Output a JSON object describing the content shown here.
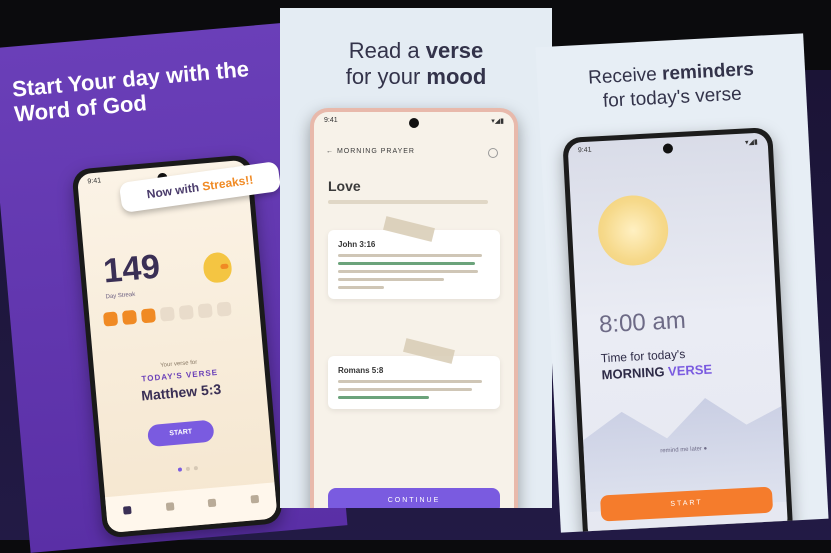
{
  "panel1": {
    "headline": "Start Your day with the Word of God",
    "status_time": "9:41",
    "status_icons": "▾◢▮",
    "streak_tag_prefix": "Now with ",
    "streak_tag_accent": "Streaks!!",
    "streak_count": "149",
    "count_caption": "Day Streak",
    "days_total": 7,
    "days_done": 3,
    "verse_kicker": "Your verse for",
    "verse_title": "TODAY'S VERSE",
    "verse_ref": "Matthew 5:3",
    "start_label": "START",
    "tabs": [
      "home",
      "bible",
      "verses",
      "more"
    ]
  },
  "panel2": {
    "headline_pre": "Read a ",
    "headline_bold1": "verse",
    "headline_mid": "for your ",
    "headline_bold2": "mood",
    "status_time": "9:41",
    "status_icons": "▾◢▮",
    "topbar": "← MORNING PRAYER",
    "mood_title": "Love",
    "card1_ref": "John 3:16",
    "card2_ref": "Romans 5:8",
    "continue_label": "CONTINUE"
  },
  "panel3": {
    "headline_pre": "Receive ",
    "headline_bold": "reminders",
    "headline_line2": "for today's verse",
    "status_time": "9:41",
    "status_icons": "▾◢▮",
    "time": "8:00 am",
    "line1": "Time for today's",
    "line2_pre": "MORNING ",
    "line2_accent": "VERSE",
    "small_line": "remind me later ●",
    "start_label": "START"
  },
  "colors": {
    "purple": "#6a3fb8",
    "accent_orange": "#f08a24",
    "button_purple": "#7a5be0",
    "button_orange": "#f57c2c"
  }
}
